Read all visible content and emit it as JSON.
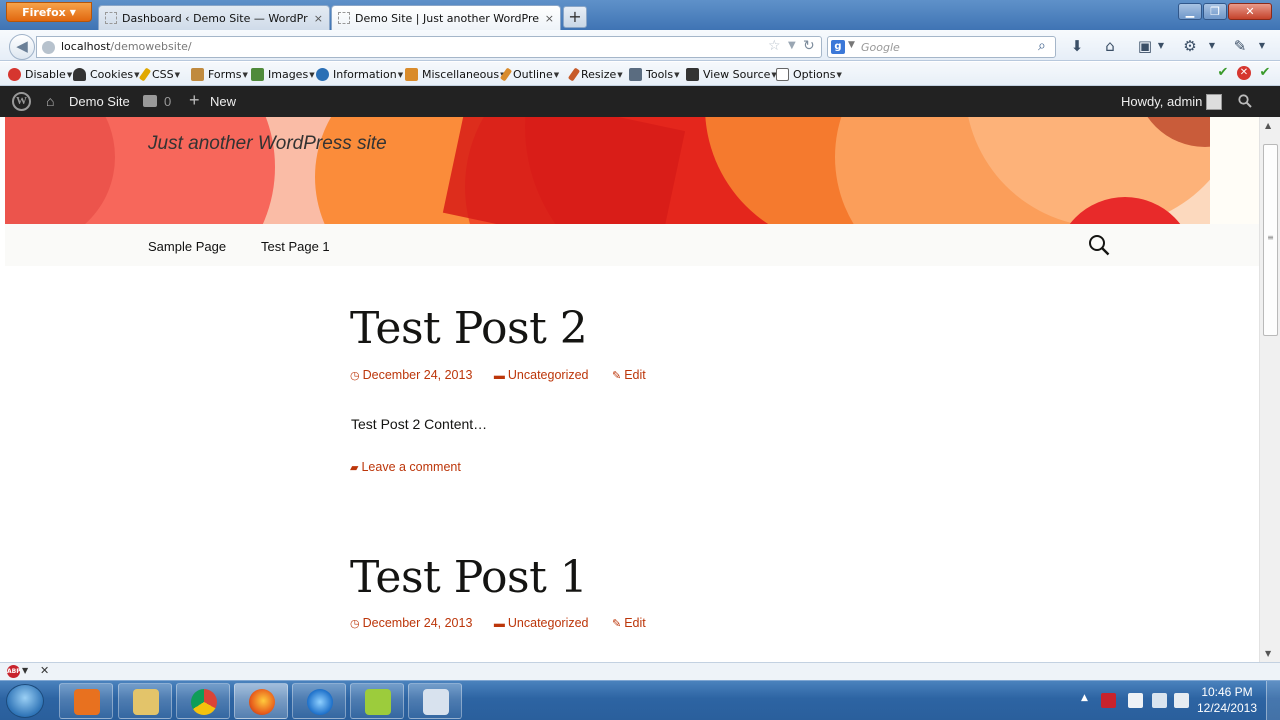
{
  "browser": {
    "app_button": "Firefox",
    "tabs": [
      {
        "title": "Dashboard ‹ Demo Site — WordPress",
        "close": "×"
      },
      {
        "title": "Demo Site | Just another WordPress site",
        "close": "×"
      }
    ],
    "new_tab": "+",
    "url_host": "localhost",
    "url_path": "/demowebsite/",
    "search_engine_icon": "google-icon",
    "search_placeholder": "Google"
  },
  "devtoolbar": {
    "items": [
      "Disable",
      "Cookies",
      "CSS",
      "Forms",
      "Images",
      "Information",
      "Miscellaneous",
      "Outline",
      "Resize",
      "Tools",
      "View Source",
      "Options"
    ],
    "colors": [
      "#d6362f",
      "#333333",
      "#e0a800",
      "#c08a3e",
      "#4f8a3a",
      "#2a6fb5",
      "#d98b2b",
      "#d98b2b",
      "#c75b2a",
      "#5a6c80",
      "#333333",
      "#666666"
    ]
  },
  "wp_admin_bar": {
    "site_name": "Demo Site",
    "comments_count": "0",
    "new_label": "New",
    "howdy": "Howdy, admin"
  },
  "site": {
    "tagline": "Just another WordPress site",
    "menu": [
      "Sample Page",
      "Test Page 1"
    ],
    "accent_color": "#bc360a"
  },
  "posts": [
    {
      "title": "Test Post 2",
      "date": "December 24, 2013",
      "category": "Uncategorized",
      "edit": "Edit",
      "content": "Test Post 2 Content…",
      "comment_link": "Leave a comment"
    },
    {
      "title": "Test Post 1",
      "date": "December 24, 2013",
      "category": "Uncategorized",
      "edit": "Edit"
    }
  ],
  "taskbar": {
    "time": "10:46 PM",
    "date": "12/24/2013"
  }
}
